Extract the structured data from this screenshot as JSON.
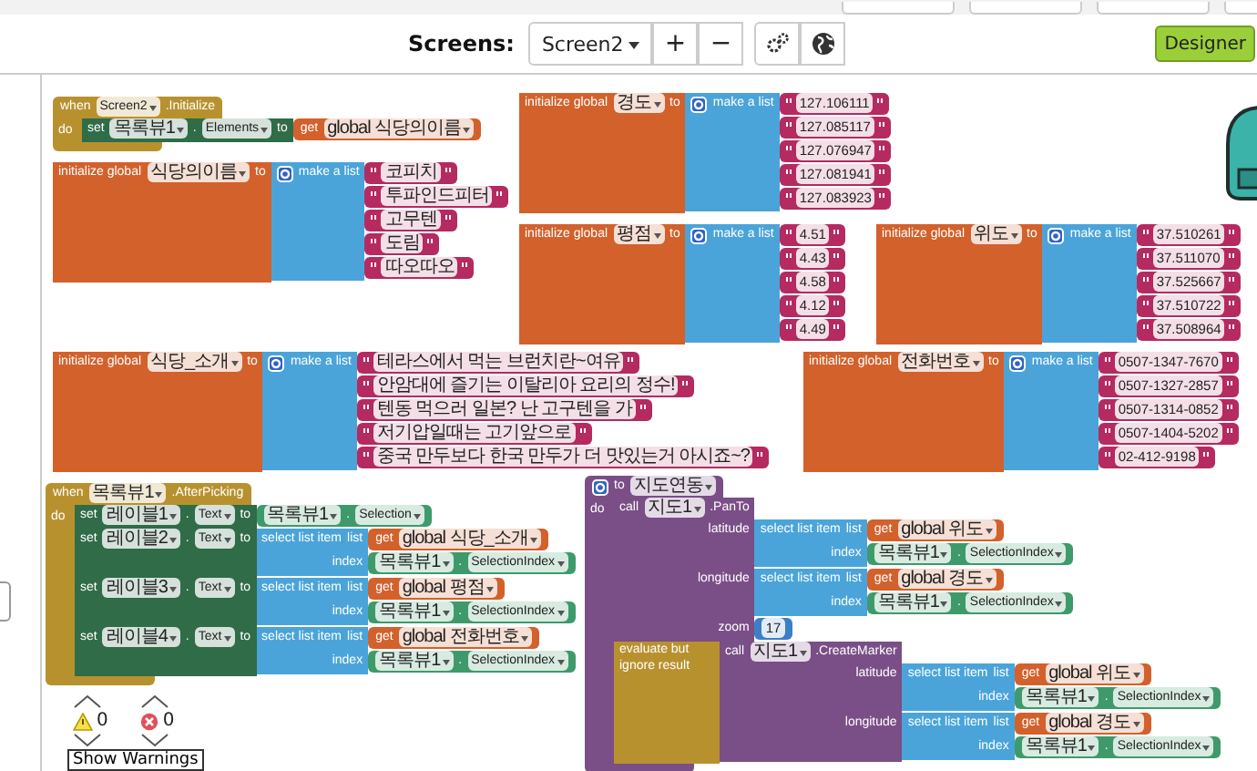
{
  "toolbar": {
    "label": "Screens:",
    "screen": "Screen2",
    "buttons": [
      {
        "kind": "text",
        "text": "+"
      },
      {
        "kind": "text",
        "text": "−"
      },
      {
        "kind": "settings"
      },
      {
        "kind": "globe"
      }
    ],
    "designer": "Designer"
  },
  "blocks": [
    {
      "kind": "event",
      "head": [
        {
          "kind": "label",
          "text": "when"
        },
        {
          "kind": "dropdown",
          "text": "Screen2"
        },
        {
          "kind": "label",
          "text": ".Initialize"
        }
      ],
      "do": "do",
      "body": [
        {
          "kind": "set",
          "inputs": [
            {
              "labels": [
                {
                  "kind": "label",
                  "text": "set"
                },
                {
                  "kind": "dropdown",
                  "text": "목록뷰1"
                },
                {
                  "kind": "label",
                  "text": "."
                },
                {
                  "kind": "dropdown",
                  "text": "Elements"
                },
                {
                  "kind": "label",
                  "text": "to"
                }
              ],
              "value": {
                "kind": "get",
                "head": [
                  {
                    "kind": "label",
                    "text": "get"
                  },
                  {
                    "kind": "dropdown",
                    "text": "global 식당의이름"
                  }
                ]
              }
            }
          ]
        }
      ]
    },
    {
      "kind": "list_init",
      "inputs": [
        {
          "labels": [
            {
              "kind": "label",
              "text": "initialize global"
            },
            {
              "kind": "dropdown",
              "text": "경도"
            },
            {
              "kind": "label",
              "text": "to"
            }
          ],
          "value": {
            "kind": "make_list",
            "inputs": [
              {
                "labels": [
                  {
                    "kind": "mutator"
                  },
                  {
                    "kind": "label",
                    "text": "make a list"
                  }
                ],
                "value": {
                  "kind": "text",
                  "text": "127.106111"
                }
              },
              {
                "value": {
                  "kind": "text",
                  "text": "127.085117"
                }
              },
              {
                "value": {
                  "kind": "text",
                  "text": "127.076947"
                }
              },
              {
                "value": {
                  "kind": "text",
                  "text": "127.081941"
                }
              },
              {
                "value": {
                  "kind": "text",
                  "text": "127.083923"
                }
              }
            ]
          }
        }
      ]
    },
    {
      "kind": "list_init",
      "inputs": [
        {
          "labels": [
            {
              "kind": "label",
              "text": "initialize global"
            },
            {
              "kind": "dropdown",
              "text": "식당의이름"
            },
            {
              "kind": "label",
              "text": "to"
            }
          ],
          "value": {
            "kind": "make_list",
            "inputs": [
              {
                "labels": [
                  {
                    "kind": "mutator"
                  },
                  {
                    "kind": "label",
                    "text": "make a list"
                  }
                ],
                "value": {
                  "kind": "text",
                  "text": "코피치"
                }
              },
              {
                "value": {
                  "kind": "text",
                  "text": "투파인드피터"
                }
              },
              {
                "value": {
                  "kind": "text",
                  "text": "고무텐"
                }
              },
              {
                "value": {
                  "kind": "text",
                  "text": "도림"
                }
              },
              {
                "value": {
                  "kind": "text",
                  "text": "따오따오"
                }
              }
            ]
          }
        }
      ]
    },
    {
      "kind": "list_init",
      "inputs": [
        {
          "labels": [
            {
              "kind": "label",
              "text": "initialize global"
            },
            {
              "kind": "dropdown",
              "text": "평점"
            },
            {
              "kind": "label",
              "text": "to"
            }
          ],
          "value": {
            "kind": "make_list",
            "inputs": [
              {
                "labels": [
                  {
                    "kind": "mutator"
                  },
                  {
                    "kind": "label",
                    "text": "make a list"
                  }
                ],
                "value": {
                  "kind": "text",
                  "text": "4.51"
                }
              },
              {
                "value": {
                  "kind": "text",
                  "text": "4.43"
                }
              },
              {
                "value": {
                  "kind": "text",
                  "text": "4.58"
                }
              },
              {
                "value": {
                  "kind": "text",
                  "text": "4.12"
                }
              },
              {
                "value": {
                  "kind": "text",
                  "text": "4.49"
                }
              }
            ]
          }
        }
      ]
    },
    {
      "kind": "list_init",
      "inputs": [
        {
          "labels": [
            {
              "kind": "label",
              "text": "initialize global"
            },
            {
              "kind": "dropdown",
              "text": "위도"
            },
            {
              "kind": "label",
              "text": "to"
            }
          ],
          "value": {
            "kind": "make_list",
            "inputs": [
              {
                "labels": [
                  {
                    "kind": "mutator"
                  },
                  {
                    "kind": "label",
                    "text": "make a list"
                  }
                ],
                "value": {
                  "kind": "text",
                  "text": "37.510261"
                }
              },
              {
                "value": {
                  "kind": "text",
                  "text": "37.511070"
                }
              },
              {
                "value": {
                  "kind": "text",
                  "text": "37.525667"
                }
              },
              {
                "value": {
                  "kind": "text",
                  "text": "37.510722"
                }
              },
              {
                "value": {
                  "kind": "text",
                  "text": "37.508964"
                }
              }
            ]
          }
        }
      ]
    },
    {
      "kind": "list_init",
      "inputs": [
        {
          "labels": [
            {
              "kind": "label",
              "text": "initialize global"
            },
            {
              "kind": "dropdown",
              "text": "식당_소개"
            },
            {
              "kind": "label",
              "text": "to"
            }
          ],
          "value": {
            "kind": "make_list",
            "inputs": [
              {
                "labels": [
                  {
                    "kind": "mutator"
                  },
                  {
                    "kind": "label",
                    "text": "make a list"
                  }
                ],
                "value": {
                  "kind": "text",
                  "text": "테라스에서 먹는 브런치란~여유"
                }
              },
              {
                "value": {
                  "kind": "text",
                  "text": "안암대에 즐기는 이탈리아 요리의 정수!"
                }
              },
              {
                "value": {
                  "kind": "text",
                  "text": "텐동 먹으러 일본? 난 고구텐을 가"
                }
              },
              {
                "value": {
                  "kind": "text",
                  "text": "저기압일때는 고기앞으로"
                }
              },
              {
                "value": {
                  "kind": "text",
                  "text": "중국 만두보다 한국 만두가 더 맛있는거 아시죠~?"
                }
              }
            ]
          }
        }
      ]
    },
    {
      "kind": "list_init",
      "inputs": [
        {
          "labels": [
            {
              "kind": "label",
              "text": "initialize global"
            },
            {
              "kind": "dropdown",
              "text": "전화번호"
            },
            {
              "kind": "label",
              "text": "to"
            }
          ],
          "value": {
            "kind": "make_list",
            "inputs": [
              {
                "labels": [
                  {
                    "kind": "mutator"
                  },
                  {
                    "kind": "label",
                    "text": "make a list"
                  }
                ],
                "value": {
                  "kind": "text",
                  "text": "0507-1347-7670"
                }
              },
              {
                "value": {
                  "kind": "text",
                  "text": "0507-1327-2857"
                }
              },
              {
                "value": {
                  "kind": "text",
                  "text": "0507-1314-0852"
                }
              },
              {
                "value": {
                  "kind": "text",
                  "text": "0507-1404-5202"
                }
              },
              {
                "value": {
                  "kind": "text",
                  "text": "02-412-9198"
                }
              }
            ]
          }
        }
      ]
    },
    {
      "kind": "event",
      "head": [
        {
          "kind": "label",
          "text": "when"
        },
        {
          "kind": "dropdown",
          "text": "목록뷰1"
        },
        {
          "kind": "label",
          "text": ".AfterPicking"
        }
      ],
      "do": "do",
      "body": [
        {
          "kind": "set",
          "inputs": [
            {
              "labels": [
                {
                  "kind": "label",
                  "text": "set"
                },
                {
                  "kind": "dropdown",
                  "text": "레이블1"
                },
                {
                  "kind": "label",
                  "text": "."
                },
                {
                  "kind": "dropdown",
                  "text": "Text"
                },
                {
                  "kind": "label",
                  "text": "to"
                }
              ],
              "value": {
                "kind": "property",
                "head": [
                  {
                    "kind": "dropdown",
                    "text": "목록뷰1"
                  },
                  {
                    "kind": "label",
                    "text": "."
                  },
                  {
                    "kind": "dropdown",
                    "text": "Selection"
                  }
                ]
              }
            }
          ]
        },
        {
          "kind": "set",
          "inputs": [
            {
              "labels": [
                {
                  "kind": "label",
                  "text": "set"
                },
                {
                  "kind": "dropdown",
                  "text": "레이블2"
                },
                {
                  "kind": "label",
                  "text": "."
                },
                {
                  "kind": "dropdown",
                  "text": "Text"
                },
                {
                  "kind": "label",
                  "text": "to"
                }
              ],
              "value": {
                "kind": "select",
                "inputs": [
                  {
                    "labels": [
                      {
                        "kind": "label",
                        "text": "select list item"
                      },
                      {
                        "kind": "label",
                        "text": "list"
                      }
                    ],
                    "value": {
                      "kind": "get",
                      "head": [
                        {
                          "kind": "label",
                          "text": "get"
                        },
                        {
                          "kind": "dropdown",
                          "text": "global 식당_소개"
                        }
                      ]
                    }
                  },
                  {
                    "labels": [
                      {
                        "kind": "label",
                        "text": "index"
                      }
                    ],
                    "value": {
                      "kind": "property",
                      "head": [
                        {
                          "kind": "dropdown",
                          "text": "목록뷰1"
                        },
                        {
                          "kind": "label",
                          "text": "."
                        },
                        {
                          "kind": "dropdown",
                          "text": "SelectionIndex"
                        }
                      ]
                    }
                  }
                ]
              }
            }
          ]
        },
        {
          "kind": "set",
          "inputs": [
            {
              "labels": [
                {
                  "kind": "label",
                  "text": "set"
                },
                {
                  "kind": "dropdown",
                  "text": "레이블3"
                },
                {
                  "kind": "label",
                  "text": "."
                },
                {
                  "kind": "dropdown",
                  "text": "Text"
                },
                {
                  "kind": "label",
                  "text": "to"
                }
              ],
              "value": {
                "kind": "select",
                "inputs": [
                  {
                    "labels": [
                      {
                        "kind": "label",
                        "text": "select list item"
                      },
                      {
                        "kind": "label",
                        "text": "list"
                      }
                    ],
                    "value": {
                      "kind": "get",
                      "head": [
                        {
                          "kind": "label",
                          "text": "get"
                        },
                        {
                          "kind": "dropdown",
                          "text": "global 평점"
                        }
                      ]
                    }
                  },
                  {
                    "labels": [
                      {
                        "kind": "label",
                        "text": "index"
                      }
                    ],
                    "value": {
                      "kind": "property",
                      "head": [
                        {
                          "kind": "dropdown",
                          "text": "목록뷰1"
                        },
                        {
                          "kind": "label",
                          "text": "."
                        },
                        {
                          "kind": "dropdown",
                          "text": "SelectionIndex"
                        }
                      ]
                    }
                  }
                ]
              }
            }
          ]
        },
        {
          "kind": "set",
          "inputs": [
            {
              "labels": [
                {
                  "kind": "label",
                  "text": "set"
                },
                {
                  "kind": "dropdown",
                  "text": "레이블4"
                },
                {
                  "kind": "label",
                  "text": "."
                },
                {
                  "kind": "dropdown",
                  "text": "Text"
                },
                {
                  "kind": "label",
                  "text": "to"
                }
              ],
              "value": {
                "kind": "select",
                "inputs": [
                  {
                    "labels": [
                      {
                        "kind": "label",
                        "text": "select list item"
                      },
                      {
                        "kind": "label",
                        "text": "list"
                      }
                    ],
                    "value": {
                      "kind": "get",
                      "head": [
                        {
                          "kind": "label",
                          "text": "get"
                        },
                        {
                          "kind": "dropdown",
                          "text": "global 전화번호"
                        }
                      ]
                    }
                  },
                  {
                    "labels": [
                      {
                        "kind": "label",
                        "text": "index"
                      }
                    ],
                    "value": {
                      "kind": "property",
                      "head": [
                        {
                          "kind": "dropdown",
                          "text": "목록뷰1"
                        },
                        {
                          "kind": "label",
                          "text": "."
                        },
                        {
                          "kind": "dropdown",
                          "text": "SelectionIndex"
                        }
                      ]
                    }
                  }
                ]
              }
            }
          ]
        }
      ]
    },
    {
      "kind": "procedure",
      "head": [
        {
          "kind": "mutator"
        },
        {
          "kind": "label",
          "text": "to"
        },
        {
          "kind": "dropdown",
          "text": "지도연동"
        }
      ],
      "do": "do",
      "body": [
        {
          "kind": "call",
          "head": [
            {
              "kind": "label",
              "text": "call"
            },
            {
              "kind": "dropdown",
              "text": "지도1"
            },
            {
              "kind": "label",
              "text": ".PanTo"
            }
          ],
          "inputs": [
            {
              "labels": [
                {
                  "kind": "label",
                  "text": "latitude"
                }
              ],
              "value": {
                "kind": "select",
                "inputs": [
                  {
                    "labels": [
                      {
                        "kind": "label",
                        "text": "select list item"
                      },
                      {
                        "kind": "label",
                        "text": "list"
                      }
                    ],
                    "value": {
                      "kind": "get",
                      "head": [
                        {
                          "kind": "label",
                          "text": "get"
                        },
                        {
                          "kind": "dropdown",
                          "text": "global 위도"
                        }
                      ]
                    }
                  },
                  {
                    "labels": [
                      {
                        "kind": "label",
                        "text": "index"
                      }
                    ],
                    "value": {
                      "kind": "property",
                      "head": [
                        {
                          "kind": "dropdown",
                          "text": "목록뷰1"
                        },
                        {
                          "kind": "label",
                          "text": "."
                        },
                        {
                          "kind": "dropdown",
                          "text": "SelectionIndex"
                        }
                      ]
                    }
                  }
                ]
              }
            },
            {
              "labels": [
                {
                  "kind": "label",
                  "text": "longitude"
                }
              ],
              "value": {
                "kind": "select",
                "inputs": [
                  {
                    "labels": [
                      {
                        "kind": "label",
                        "text": "select list item"
                      },
                      {
                        "kind": "label",
                        "text": "list"
                      }
                    ],
                    "value": {
                      "kind": "get",
                      "head": [
                        {
                          "kind": "label",
                          "text": "get"
                        },
                        {
                          "kind": "dropdown",
                          "text": "global 경도"
                        }
                      ]
                    }
                  },
                  {
                    "labels": [
                      {
                        "kind": "label",
                        "text": "index"
                      }
                    ],
                    "value": {
                      "kind": "property",
                      "head": [
                        {
                          "kind": "dropdown",
                          "text": "목록뷰1"
                        },
                        {
                          "kind": "label",
                          "text": "."
                        },
                        {
                          "kind": "dropdown",
                          "text": "SelectionIndex"
                        }
                      ]
                    }
                  }
                ]
              }
            },
            {
              "labels": [
                {
                  "kind": "label",
                  "text": "zoom"
                }
              ],
              "value": {
                "kind": "number",
                "head": [
                  {
                    "kind": "number",
                    "text": "17"
                  }
                ]
              }
            }
          ]
        },
        {
          "kind": "evaluate",
          "inputs": [
            {
              "labels": [
                {
                  "kind": "label",
                  "text": "evaluate but ignore result"
                }
              ],
              "value": {
                "kind": "call",
                "head": [
                  {
                    "kind": "label",
                    "text": "call"
                  },
                  {
                    "kind": "dropdown",
                    "text": "지도1"
                  },
                  {
                    "kind": "label",
                    "text": ".CreateMarker"
                  }
                ],
                "inputs": [
                  {
                    "labels": [
                      {
                        "kind": "label",
                        "text": "latitude"
                      }
                    ],
                    "value": {
                      "kind": "select",
                      "inputs": [
                        {
                          "labels": [
                            {
                              "kind": "label",
                              "text": "select list item"
                            },
                            {
                              "kind": "label",
                              "text": "list"
                            }
                          ],
                          "value": {
                            "kind": "get",
                            "head": [
                              {
                                "kind": "label",
                                "text": "get"
                              },
                              {
                                "kind": "dropdown",
                                "text": "global 위도"
                              }
                            ]
                          }
                        },
                        {
                          "labels": [
                            {
                              "kind": "label",
                              "text": "index"
                            }
                          ],
                          "value": {
                            "kind": "property",
                            "head": [
                              {
                                "kind": "dropdown",
                                "text": "목록뷰1"
                              },
                              {
                                "kind": "label",
                                "text": "."
                              },
                              {
                                "kind": "dropdown",
                                "text": "SelectionIndex"
                              }
                            ]
                          }
                        }
                      ]
                    }
                  },
                  {
                    "labels": [
                      {
                        "kind": "label",
                        "text": "longitude"
                      }
                    ],
                    "value": {
                      "kind": "select",
                      "inputs": [
                        {
                          "labels": [
                            {
                              "kind": "label",
                              "text": "select list item"
                            },
                            {
                              "kind": "label",
                              "text": "list"
                            }
                          ],
                          "value": {
                            "kind": "get",
                            "head": [
                              {
                                "kind": "label",
                                "text": "get"
                              },
                              {
                                "kind": "dropdown",
                                "text": "global 경도"
                              }
                            ]
                          }
                        },
                        {
                          "labels": [
                            {
                              "kind": "label",
                              "text": "index"
                            }
                          ],
                          "value": {
                            "kind": "property",
                            "head": [
                              {
                                "kind": "dropdown",
                                "text": "목록뷰1"
                              },
                              {
                                "kind": "label",
                                "text": "."
                              },
                              {
                                "kind": "dropdown",
                                "text": "SelectionIndex"
                              }
                            ]
                          }
                        }
                      ]
                    }
                  }
                ]
              }
            }
          ]
        }
      ]
    }
  ],
  "warnings": {
    "warning_count": "0",
    "error_count": "0",
    "button": "Show Warnings"
  }
}
